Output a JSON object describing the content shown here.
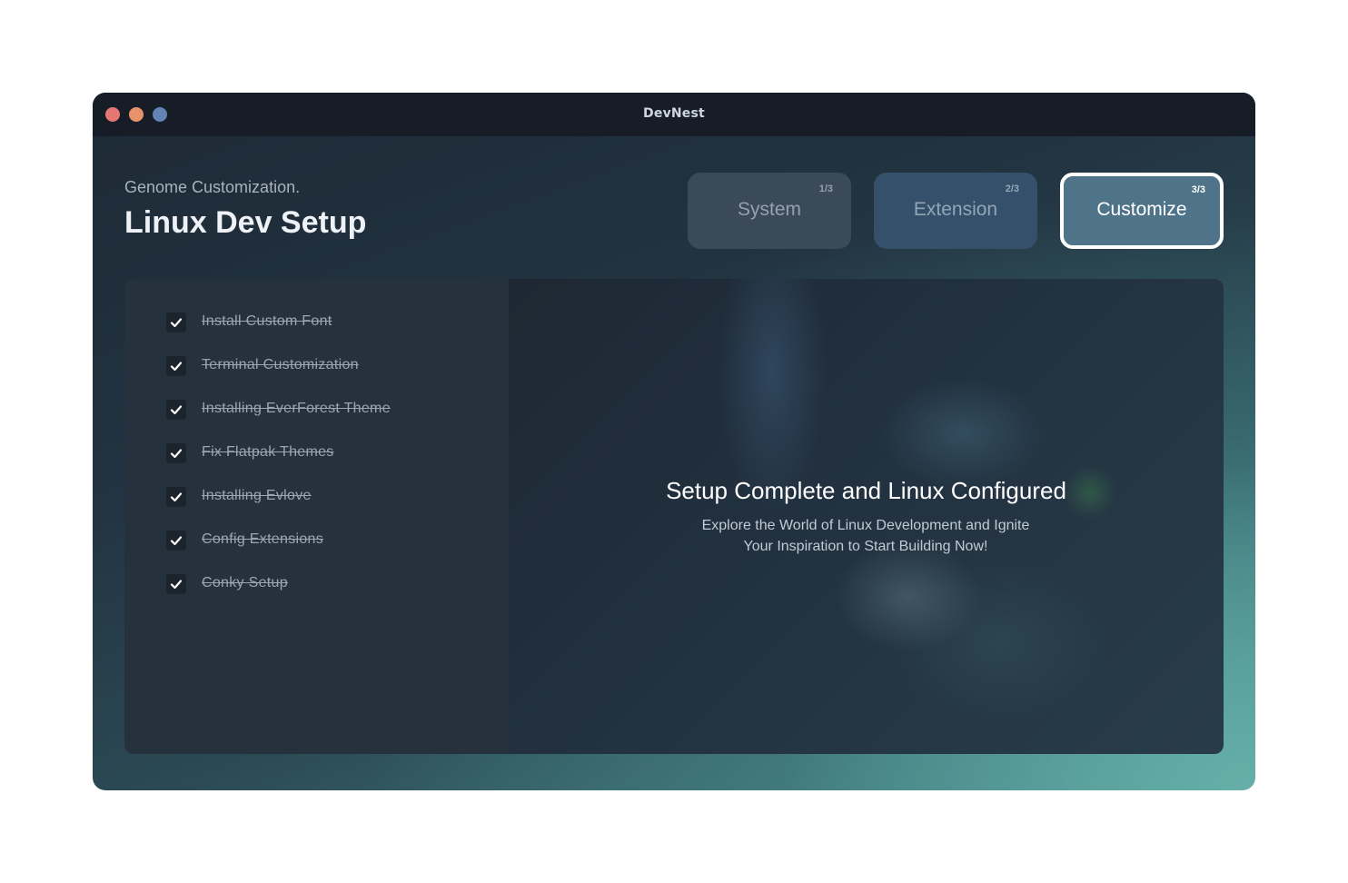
{
  "window": {
    "title": "DevNest",
    "controls": {
      "close_color": "#e57772",
      "minimize_color": "#e6936a",
      "maximize_color": "#6284b4"
    }
  },
  "header": {
    "subtitle": "Genome Customization.",
    "title": "Linux Dev Setup"
  },
  "steps": [
    {
      "label": "System",
      "number": "1/3",
      "active": false
    },
    {
      "label": "Extension",
      "number": "2/3",
      "active": false
    },
    {
      "label": "Customize",
      "number": "3/3",
      "active": true
    }
  ],
  "tasks": [
    {
      "label": "Install Custom Font",
      "done": true,
      "icon": "check-icon"
    },
    {
      "label": "Terminal Customization",
      "done": true,
      "icon": "check-icon"
    },
    {
      "label": "Installing EverForest Theme",
      "done": true,
      "icon": "check-icon"
    },
    {
      "label": "Fix Flatpak Themes",
      "done": true,
      "icon": "check-icon"
    },
    {
      "label": "Installing Evlove",
      "done": true,
      "icon": "check-icon"
    },
    {
      "label": "Config Extensions",
      "done": true,
      "icon": "check-icon"
    },
    {
      "label": "Conky Setup",
      "done": true,
      "icon": "check-icon"
    }
  ],
  "completion": {
    "title": "Setup Complete and Linux Configured",
    "line1": "Explore the World of Linux Development and Ignite",
    "line2": "Your Inspiration to Start Building Now!"
  }
}
